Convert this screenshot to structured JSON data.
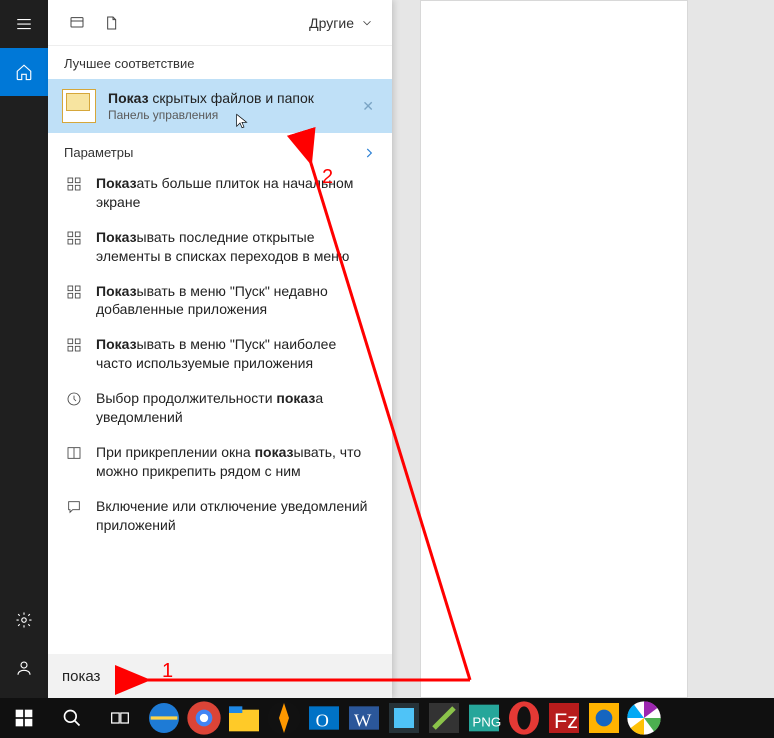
{
  "header": {
    "filter_label": "Другие"
  },
  "rail": {
    "menu": "menu",
    "home": "home",
    "settings": "settings",
    "user": "user"
  },
  "bestmatch": {
    "section_label": "Лучшее соответствие",
    "title_bold": "Показ",
    "title_rest": " скрытых файлов и папок",
    "subtitle": "Панель управления"
  },
  "category": {
    "label": "Параметры"
  },
  "results": [
    {
      "bold": "Показ",
      "rest": "ать больше плиток на начальном экране",
      "icon": "tiles"
    },
    {
      "bold": "Показ",
      "rest": "ывать последние открытые элементы в списках переходов в меню",
      "icon": "tiles"
    },
    {
      "bold": "Показ",
      "rest": "ывать в меню \"Пуск\" недавно добавленные приложения",
      "icon": "tiles"
    },
    {
      "bold": "Показ",
      "rest": "ывать в меню \"Пуск\" наиболее часто используемые приложения",
      "icon": "tiles"
    },
    {
      "pre": "Выбор продолжительности ",
      "bold": "показ",
      "rest": "а уведомлений",
      "icon": "clock"
    },
    {
      "pre": "При прикреплении окна ",
      "bold": "показ",
      "rest": "ывать, что можно прикрепить рядом с ним",
      "icon": "snap"
    },
    {
      "pre": "Включение или отключение уведомлений приложений",
      "bold": "",
      "rest": "",
      "icon": "chat"
    }
  ],
  "search": {
    "value": "показ"
  },
  "annotations": {
    "label1": "1",
    "label2": "2"
  },
  "taskbar": {
    "apps": [
      "ie",
      "chrome",
      "explorer",
      "aimp",
      "outlook",
      "word",
      "paint",
      "npp",
      "png",
      "opera",
      "filezilla",
      "teamviewer",
      "picasa"
    ]
  }
}
